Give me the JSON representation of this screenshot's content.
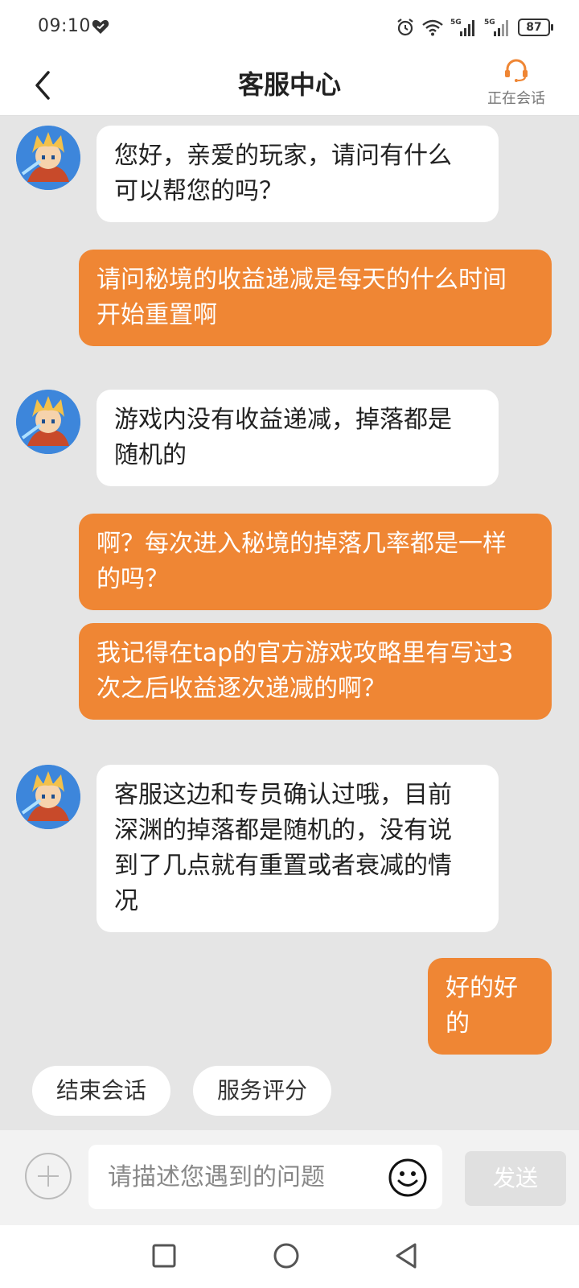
{
  "status_bar": {
    "time": "09:10",
    "battery": "87",
    "network_label": "5G"
  },
  "header": {
    "title": "客服中心",
    "session_status": "正在会话"
  },
  "messages": [
    {
      "side": "in",
      "lines": [
        "您好，亲爱的玩家，请问有什么",
        "可以帮您的吗？"
      ]
    },
    {
      "side": "out",
      "lines": [
        "请问秘境的收益递减是每天的什么时间",
        "开始重置啊"
      ]
    },
    {
      "side": "in",
      "lines": [
        "游戏内没有收益递减，掉落都是",
        "随机的"
      ]
    },
    {
      "side": "out",
      "lines": [
        "啊？每次进入秘境的掉落几率都是一样",
        "的吗？"
      ]
    },
    {
      "side": "out",
      "lines": [
        "我记得在tap的官方游戏攻略里有写过3",
        "次之后收益逐次递减的啊？"
      ]
    },
    {
      "side": "in",
      "lines": [
        "客服这边和专员确认过哦，目前",
        "深渊的掉落都是随机的，没有说",
        "到了几点就有重置或者衰减的情",
        "况"
      ]
    },
    {
      "side": "out",
      "lines": [
        "好的好的"
      ]
    }
  ],
  "quick_actions": {
    "end_session": "结束会话",
    "rate_service": "服务评分"
  },
  "input": {
    "placeholder": "请描述您遇到的问题",
    "send_label": "发送"
  },
  "colors": {
    "accent": "#ef8634",
    "incoming_bubble": "#ffffff",
    "chat_background": "#e5e5e5"
  },
  "icons": {
    "back": "chevron-left-icon",
    "headset": "headset-icon",
    "plus": "plus-icon",
    "emoji": "smiley-icon",
    "nav_recent": "square-icon",
    "nav_home": "circle-icon",
    "nav_back": "triangle-icon"
  }
}
